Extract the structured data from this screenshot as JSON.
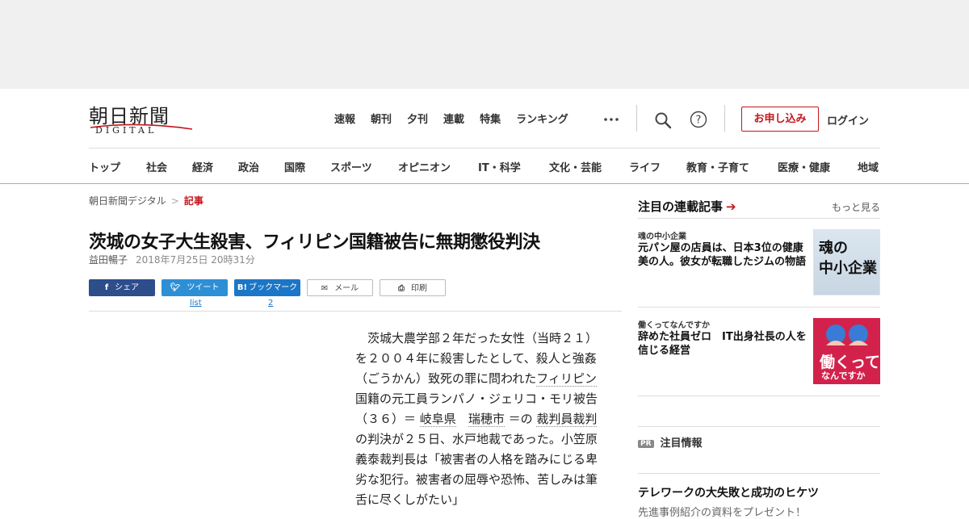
{
  "header": {
    "logo_kanji": "朝日新聞",
    "logo_sub": "DIGITAL",
    "topnav": [
      "速報",
      "朝刊",
      "夕刊",
      "連載",
      "特集",
      "ランキング"
    ],
    "subscribe_label": "お申し込み",
    "login_label": "ログイン",
    "brand_color": "#c4161c"
  },
  "category_nav": [
    "トップ",
    "社会",
    "経済",
    "政治",
    "国際",
    "スポーツ",
    "オピニオン",
    "IT・科学",
    "文化・芸能",
    "ライフ",
    "教育・子育て",
    "医療・健康",
    "地域"
  ],
  "breadcrumb": {
    "home": "朝日新聞デジタル",
    "sep": ">",
    "current": "記事"
  },
  "article": {
    "title": "茨城の女子大生殺害、フィリピン国籍被告に無期懲役判決",
    "author": "益田暢子",
    "date": "2018年7月25日 20時31分",
    "share": {
      "facebook": "シェア",
      "twitter": "ツイート",
      "twitter_count": "list",
      "hatena": "ブックマーク",
      "hatena_count": "2",
      "mail": "メール",
      "print": "印刷"
    },
    "body": {
      "p1_a": "茨城大農学部２年だった女性（当時２１）を２００４年に殺害したとして、殺人と強姦（ごうかん）致死の罪に問われた",
      "link_philippines": "フィリピン",
      "p1_b": "国籍の元工員ランパノ・ジェリコ・モリ被告（３６）＝",
      "link_gifu": "岐阜県",
      "link_mizuho": "瑞穂市",
      "p1_c": "＝の",
      "link_saibanin": "裁判員裁判",
      "p1_d": "の判決が２５日、水戸地裁であった。小笠原義泰裁判長は「被害者の人格を踏みにじる卑劣な犯行。被害者の屈辱や恐怖、苦しみは筆舌に尽くしがたい」"
    }
  },
  "sidebar": {
    "title": "注目の連載記事",
    "more": "もっと見る",
    "items": [
      {
        "series": "魂の中小企業",
        "headline": "元パン屋の店員は、日本3位の健康美の人。彼女が転職したジムの物語",
        "thumb_text_1": "魂の",
        "thumb_text_2": "中小企業"
      },
      {
        "series": "働くってなんですか",
        "headline": "辞めた社員ゼロ　IT出身社長の人を信じる経営",
        "thumb_text_1": "働くって",
        "thumb_text_2": "なんですか"
      }
    ],
    "pr_badge": "PR",
    "pr_label": "注目情報",
    "pr_headline": "テレワークの大失敗と成功のヒケツ",
    "pr_sub": "先進事例紹介の資料をプレゼント！"
  }
}
